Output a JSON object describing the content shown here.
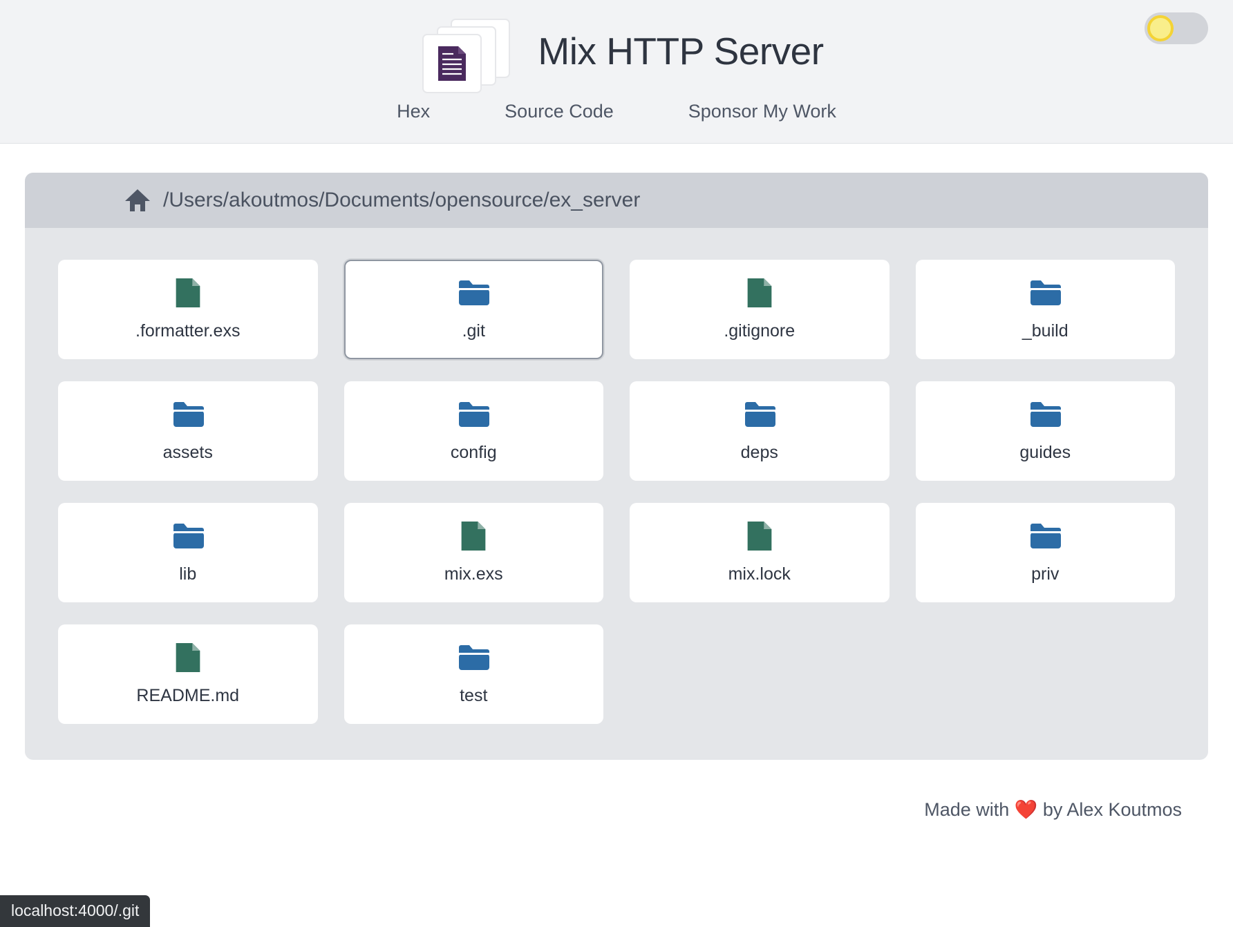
{
  "header": {
    "title": "Mix HTTP Server",
    "logo_icon": "document-stack-icon",
    "nav": [
      {
        "label": "Hex",
        "name": "nav-link-hex"
      },
      {
        "label": "Source Code",
        "name": "nav-link-source-code"
      },
      {
        "label": "Sponsor My Work",
        "name": "nav-link-sponsor-my-work"
      }
    ],
    "theme_toggle": {
      "icon": "sun-icon",
      "state": "light",
      "track_color": "#d2d4d9",
      "knob_color": "#f9ee8b",
      "knob_border_color": "#f4d335"
    }
  },
  "explorer": {
    "home_icon": "home-icon",
    "path": "/Users/akoutmos/Documents/opensource/ex_server",
    "path_bar_color": "#ced1d7",
    "panel_color": "#e4e6e9",
    "file_icon_color": "#33715f",
    "folder_icon_color": "#2c6ca6",
    "entries": [
      {
        "label": ".formatter.exs",
        "type": "file",
        "icon": "file-icon",
        "focused": false
      },
      {
        "label": ".git",
        "type": "folder",
        "icon": "folder-icon",
        "focused": true
      },
      {
        "label": ".gitignore",
        "type": "file",
        "icon": "file-icon",
        "focused": false
      },
      {
        "label": "_build",
        "type": "folder",
        "icon": "folder-icon",
        "focused": false
      },
      {
        "label": "assets",
        "type": "folder",
        "icon": "folder-icon",
        "focused": false
      },
      {
        "label": "config",
        "type": "folder",
        "icon": "folder-icon",
        "focused": false
      },
      {
        "label": "deps",
        "type": "folder",
        "icon": "folder-icon",
        "focused": false
      },
      {
        "label": "guides",
        "type": "folder",
        "icon": "folder-icon",
        "focused": false
      },
      {
        "label": "lib",
        "type": "folder",
        "icon": "folder-icon",
        "focused": false
      },
      {
        "label": "mix.exs",
        "type": "file",
        "icon": "file-icon",
        "focused": false
      },
      {
        "label": "mix.lock",
        "type": "file",
        "icon": "file-icon",
        "focused": false
      },
      {
        "label": "priv",
        "type": "folder",
        "icon": "folder-icon",
        "focused": false
      },
      {
        "label": "README.md",
        "type": "file",
        "icon": "file-icon",
        "focused": false
      },
      {
        "label": "test",
        "type": "folder",
        "icon": "folder-icon",
        "focused": false
      }
    ]
  },
  "footer": {
    "prefix": "Made with ",
    "heart": "❤️",
    "suffix": " by Alex Koutmos"
  },
  "status_bar": {
    "url": "localhost:4000/.git"
  }
}
